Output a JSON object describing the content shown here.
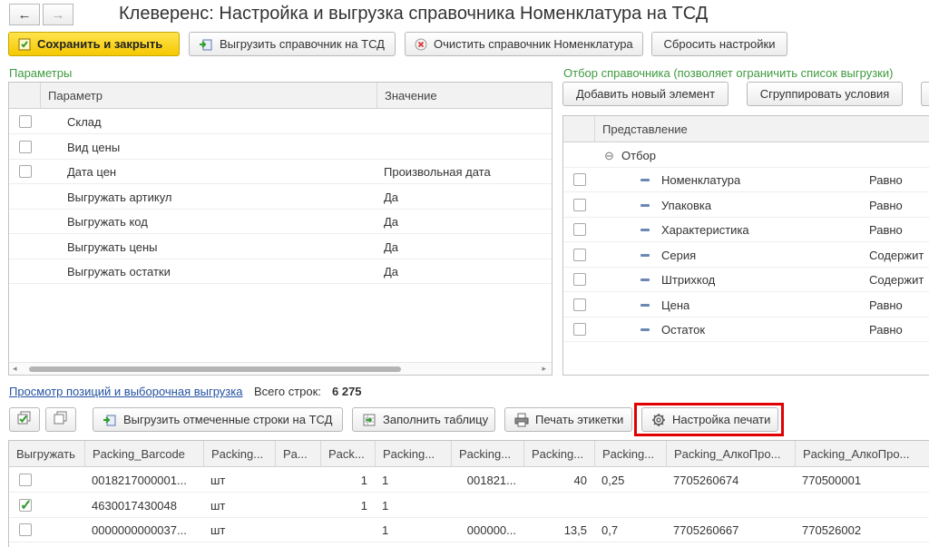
{
  "nav": {
    "back": "←",
    "forward": "→"
  },
  "window_title": "Клеверенс: Настройка и выгрузка справочника Номенклатура на ТСД",
  "toolbar": {
    "save_close": "Сохранить и закрыть",
    "export_ref": "Выгрузить справочник на ТСД",
    "clear_ref": "Очистить справочник Номенклатура",
    "reset": "Сбросить настройки"
  },
  "params": {
    "label": "Параметры",
    "col_param": "Параметр",
    "col_value": "Значение",
    "rows": [
      {
        "name": "Склад",
        "value": "",
        "checkbox": true
      },
      {
        "name": "Вид цены",
        "value": "",
        "checkbox": true
      },
      {
        "name": "Дата цен",
        "value": "Произвольная дата",
        "checkbox": true
      },
      {
        "name": "Выгружать артикул",
        "value": "Да",
        "checkbox": false
      },
      {
        "name": "Выгружать код",
        "value": "Да",
        "checkbox": false
      },
      {
        "name": "Выгружать цены",
        "value": "Да",
        "checkbox": false
      },
      {
        "name": "Выгружать остатки",
        "value": "Да",
        "checkbox": false
      }
    ]
  },
  "filter": {
    "label": "Отбор справочника (позволяет ограничить список выгрузки)",
    "add_button": "Добавить новый элемент",
    "group_button": "Сгруппировать условия",
    "col_repr": "Представление",
    "group_name": "Отбор",
    "group_toggle": "⊖",
    "rows": [
      {
        "name": "Номенклатура",
        "cond": "Равно"
      },
      {
        "name": "Упаковка",
        "cond": "Равно"
      },
      {
        "name": "Характеристика",
        "cond": "Равно"
      },
      {
        "name": "Серия",
        "cond": "Содержит"
      },
      {
        "name": "Штрихкод",
        "cond": "Содержит"
      },
      {
        "name": "Цена",
        "cond": "Равно"
      },
      {
        "name": "Остаток",
        "cond": "Равно"
      }
    ]
  },
  "preview": {
    "link": "Просмотр позиций и выборочная выгрузка",
    "total_label": "Всего строк:",
    "total_value": "6 275",
    "export_marked": "Выгрузить отмеченные строки на ТСД",
    "fill_table": "Заполнить таблицу",
    "print_labels": "Печать этикетки",
    "print_settings": "Настройка печати"
  },
  "table": {
    "columns": [
      "Выгружать",
      "Packing_Barcode",
      "Packing...",
      "Pa...",
      "Pack...",
      "Packing...",
      "Packing...",
      "Packing...",
      "Packing...",
      "Packing_АлкоПро...",
      "Packing_АлкоПро..."
    ],
    "rows": [
      {
        "checked": false,
        "cells": [
          "0018217000001...",
          "шт",
          "",
          "1",
          "1",
          "001821...",
          "40",
          "0,25",
          "7705260674",
          "770500001"
        ]
      },
      {
        "checked": true,
        "cells": [
          "4630017430048",
          "шт",
          "",
          "1",
          "1",
          "",
          "",
          "",
          "",
          ""
        ]
      },
      {
        "checked": false,
        "cells": [
          "0000000000037...",
          "шт",
          "",
          "",
          "1",
          "000000...",
          "13,5",
          "0,7",
          "7705260667",
          "770526002"
        ]
      }
    ]
  }
}
